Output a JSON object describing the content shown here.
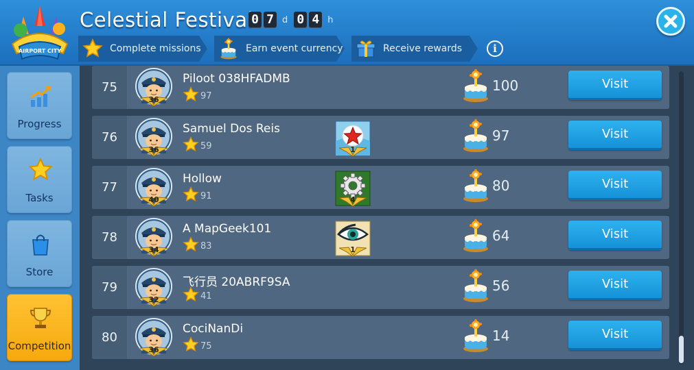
{
  "event": {
    "title": "Celestial Festival",
    "logo_text": "AIRPORT CITY",
    "timer": {
      "days": [
        "0",
        "7"
      ],
      "days_unit": "d",
      "hours": [
        "0",
        "4"
      ],
      "hours_unit": "h"
    }
  },
  "steps": [
    {
      "label": "Complete missions",
      "icon": "star-icon"
    },
    {
      "label": "Earn event currency",
      "icon": "cake-icon"
    },
    {
      "label": "Receive rewards",
      "icon": "gift-icon"
    }
  ],
  "info_label": "i",
  "sidebar": {
    "items": [
      {
        "label": "Progress",
        "icon": "progress-chart-icon",
        "active": false
      },
      {
        "label": "Tasks",
        "icon": "star-icon",
        "active": false
      },
      {
        "label": "Store",
        "icon": "shopping-bag-icon",
        "active": false
      },
      {
        "label": "Competition",
        "icon": "trophy-icon",
        "active": true
      }
    ]
  },
  "visit_label": "Visit",
  "rows": [
    {
      "rank": "75",
      "name": "Piloot 038HFADMB",
      "level": "36",
      "stars": "97",
      "badge": null,
      "badge_level": null,
      "currency": "100"
    },
    {
      "rank": "76",
      "name": "Samuel Dos Reis",
      "level": "36",
      "stars": "59",
      "badge": "red-star-badge",
      "badge_level": "1",
      "currency": "97"
    },
    {
      "rank": "77",
      "name": "Hollow",
      "level": "40",
      "stars": "91",
      "badge": "gear-badge",
      "badge_level": "4",
      "currency": "80"
    },
    {
      "rank": "78",
      "name": "A MapGeek101",
      "level": "34",
      "stars": "83",
      "badge": "eye-badge",
      "badge_level": "1",
      "currency": "64"
    },
    {
      "rank": "79",
      "name": "飞行员 20ABRF9SA",
      "level": "32",
      "stars": "41",
      "badge": null,
      "badge_level": null,
      "currency": "56"
    },
    {
      "rank": "80",
      "name": "CociNanDi",
      "level": "36",
      "stars": "75",
      "badge": null,
      "badge_level": null,
      "currency": "14"
    }
  ],
  "colors": {
    "header_blue": "#1c6fbd",
    "visit_blue": "#1692d8",
    "active_tab": "#f5a90e",
    "row_bg": "#4f6781"
  }
}
